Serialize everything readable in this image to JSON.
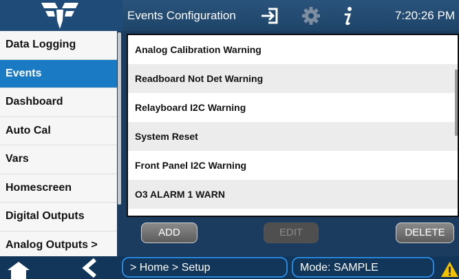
{
  "header": {
    "title": "Events Configuration",
    "time": "7:20:26 PM",
    "icons": [
      "logo-icon",
      "exit-icon",
      "gear-icon",
      "info-icon"
    ]
  },
  "sidebar": {
    "items": [
      {
        "label": "Data Logging"
      },
      {
        "label": "Events"
      },
      {
        "label": "Dashboard"
      },
      {
        "label": "Auto Cal"
      },
      {
        "label": "Vars"
      },
      {
        "label": "Homescreen"
      },
      {
        "label": "Digital Outputs"
      },
      {
        "label": "Analog Outputs >"
      }
    ],
    "active_index": 1
  },
  "events": {
    "rows": [
      "Analog Calibration Warning",
      "Readboard Not Det Warning",
      "Relayboard I2C Warning",
      "System Reset",
      "Front Panel I2C Warning",
      "O3 ALARM 1 WARN"
    ]
  },
  "buttons": {
    "add": "ADD",
    "edit": "EDIT",
    "delete": "DELETE"
  },
  "footer": {
    "breadcrumb": "> Home > Setup",
    "mode": "Mode: SAMPLE",
    "icons": [
      "home-icon",
      "back-icon",
      "warning-icon"
    ]
  },
  "colors": {
    "accent": "#1a7ac3",
    "header_bg": "#1e4468",
    "warning": "#f2c100"
  }
}
